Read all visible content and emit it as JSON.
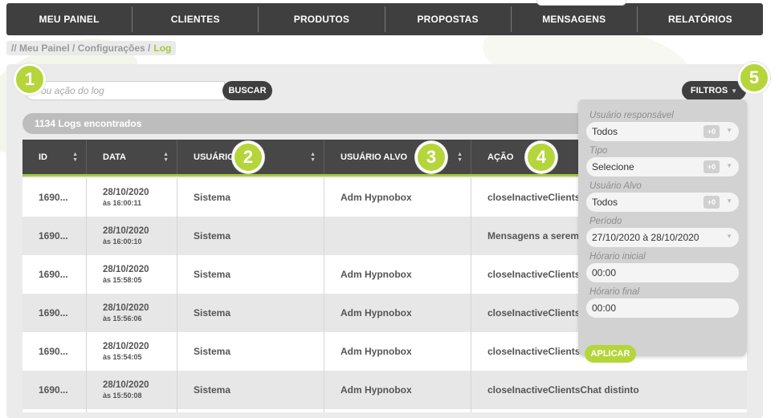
{
  "nav": {
    "items": [
      "MEU PAINEL",
      "CLIENTES",
      "PRODUTOS",
      "PROPOSTAS",
      "MENSAGENS",
      "RELATÓRIOS"
    ]
  },
  "breadcrumb": {
    "prefix": "// Meu Painel / Configurações /",
    "active": "Log"
  },
  "badges": [
    "1",
    "2",
    "3",
    "4",
    "5"
  ],
  "search": {
    "placeholder": "ou ação do log",
    "button_label": "BUSCAR"
  },
  "filters": {
    "button_label": "FILTROS",
    "fields": [
      {
        "label": "Usuário responsável",
        "value": "Todos",
        "extra": "+0"
      },
      {
        "label": "Tipo",
        "value": "Selecione",
        "extra": "+0"
      },
      {
        "label": "Usuário Alvo",
        "value": "Todos",
        "extra": "+0"
      },
      {
        "label": "Período",
        "value": "27/10/2020 à 28/10/2020"
      },
      {
        "label": "Hórario inicial",
        "value": "00:00"
      },
      {
        "label": "Hórario final",
        "value": "00:00"
      }
    ],
    "apply_label": "APLICAR"
  },
  "results": {
    "count_text": "1134 Logs encontrados"
  },
  "table": {
    "headers": [
      "ID",
      "DATA",
      "USUÁRIO",
      "USUÁRIO ALVO",
      "AÇÃO"
    ],
    "rows": [
      {
        "id": "1690...",
        "date": "28/10/2020",
        "time": "às 16:00:11",
        "user": "Sistema",
        "target": "Adm Hypnobox",
        "action": "closeInactiveClientsChat"
      },
      {
        "id": "1690...",
        "date": "28/10/2020",
        "time": "às 16:00:10",
        "user": "Sistema",
        "target": "",
        "action": "Mensagens a serem di"
      },
      {
        "id": "1690...",
        "date": "28/10/2020",
        "time": "às 15:58:05",
        "user": "Sistema",
        "target": "Adm Hypnobox",
        "action": "closeInactiveClientsCh"
      },
      {
        "id": "1690...",
        "date": "28/10/2020",
        "time": "às 15:56:06",
        "user": "Sistema",
        "target": "Adm Hypnobox",
        "action": "closeInactiveClientsCh"
      },
      {
        "id": "1690...",
        "date": "28/10/2020",
        "time": "às 15:54:05",
        "user": "Sistema",
        "target": "Adm Hypnobox",
        "action": "closeInactiveClientsCh"
      },
      {
        "id": "1690...",
        "date": "28/10/2020",
        "time": "às 15:50:08",
        "user": "Sistema",
        "target": "Adm Hypnobox",
        "action": "closeInactiveClientsChat distinto"
      }
    ]
  },
  "colors": {
    "accent": "#a5c93a",
    "badge": "#b6d53b",
    "dark": "#3f3f3f"
  }
}
